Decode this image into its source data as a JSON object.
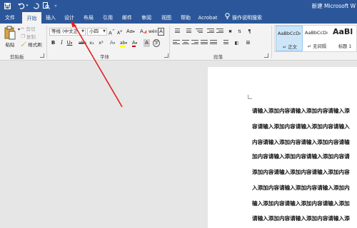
{
  "window": {
    "title": "新建 Microsoft W"
  },
  "tabs": [
    {
      "label": "文件"
    },
    {
      "label": "开始"
    },
    {
      "label": "插入"
    },
    {
      "label": "设计"
    },
    {
      "label": "布局"
    },
    {
      "label": "引用"
    },
    {
      "label": "邮件"
    },
    {
      "label": "审阅"
    },
    {
      "label": "视图"
    },
    {
      "label": "帮助"
    },
    {
      "label": "Acrobat"
    }
  ],
  "tell_me": {
    "label": "操作说明搜索"
  },
  "clipboard": {
    "paste_label": "粘贴",
    "cut_label": "剪切",
    "copy_label": "复制",
    "format_painter_label": "格式刷",
    "group_label": "剪贴板"
  },
  "font": {
    "font_name": "等线 (中文正",
    "font_size": "小四",
    "grow": "A",
    "shrink": "A",
    "case": "Aa",
    "clear": "A",
    "wen": "wén",
    "char_border": "A",
    "bold": "B",
    "italic": "I",
    "underline": "U",
    "strike": "abc",
    "subscript": "x₂",
    "superscript": "x²",
    "effect": "A",
    "highlight": "ab",
    "font_color": "A",
    "char_shade": "A",
    "enclose": "字",
    "group_label": "字体",
    "accent_red": "#c00000",
    "highlight_yellow": "#ffff00"
  },
  "paragraph": {
    "group_label": "段落"
  },
  "styles": {
    "items": [
      {
        "sample": "AaBbCcDı",
        "name": "↵ 正文"
      },
      {
        "sample": "AaBbCcDı",
        "name": "↵ 无间隔"
      },
      {
        "sample": "AaBl",
        "name": "标题 1"
      }
    ]
  },
  "document": {
    "lines": [
      "请输入添加内容请输入添加内容请输入添",
      "容请输入添加内容请输入添加内容请输入",
      "内容请输入添加内容请输入添加内容请输",
      "加内容请输入添加内容请输入添加内容请",
      "添加内容请输入添加内容请输入添加内容",
      "入添加内容请输入添加内容请输入添加内",
      "输入添加内容请输入添加内容请输入添加",
      "请输入添加内容请输入添加内容请输入添"
    ]
  },
  "colors": {
    "brand": "#2b579a",
    "ribbon_bg": "#f3f3f3",
    "annotation_arrow": "#e02020"
  }
}
